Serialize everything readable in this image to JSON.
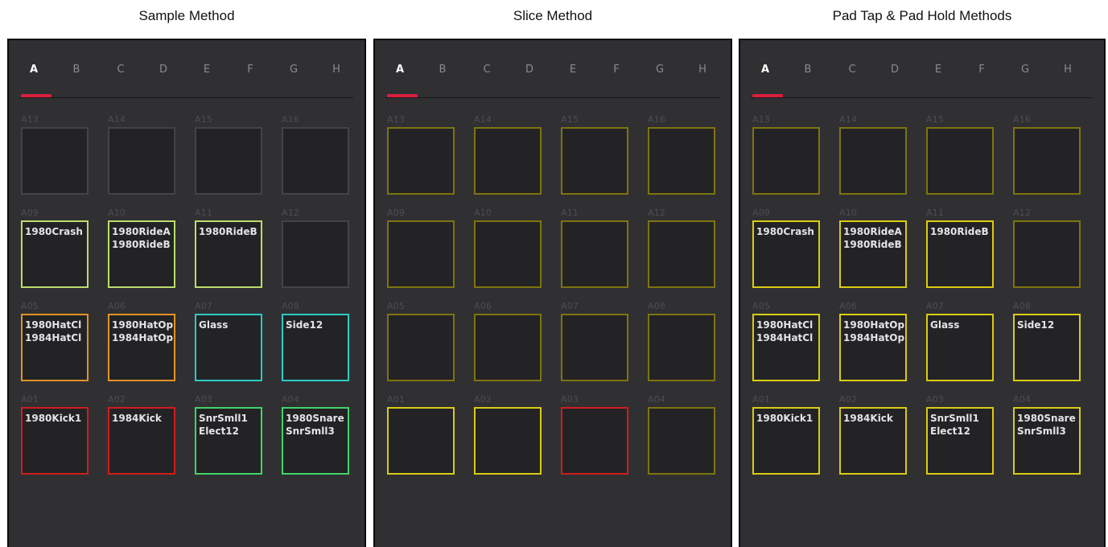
{
  "colors": {
    "empty": "#444447",
    "lime": "#bcdc6a",
    "orange": "#e29324",
    "cyan": "#2ccac3",
    "red": "#d11c1c",
    "green": "#3fd468",
    "yellow": "#d9cc12",
    "dim_yellow": "#7e740e",
    "tab_indicator": "#d81e3b"
  },
  "bank_tabs": [
    "A",
    "B",
    "C",
    "D",
    "E",
    "F",
    "G",
    "H"
  ],
  "active_tab": "A",
  "panels": [
    {
      "caption": "Sample Method",
      "rows": [
        [
          {
            "label": "A13",
            "text": "",
            "color": "empty"
          },
          {
            "label": "A14",
            "text": "",
            "color": "empty"
          },
          {
            "label": "A15",
            "text": "",
            "color": "empty"
          },
          {
            "label": "A16",
            "text": "",
            "color": "empty"
          }
        ],
        [
          {
            "label": "A09",
            "text": "1980Crash",
            "color": "lime"
          },
          {
            "label": "A10",
            "text": "1980RideA\n1980RideB",
            "color": "lime"
          },
          {
            "label": "A11",
            "text": "1980RideB",
            "color": "lime"
          },
          {
            "label": "A12",
            "text": "",
            "color": "empty"
          }
        ],
        [
          {
            "label": "A05",
            "text": "1980HatCl\n1984HatCl",
            "color": "orange"
          },
          {
            "label": "A06",
            "text": "1980HatOp\n1984HatOp",
            "color": "orange"
          },
          {
            "label": "A07",
            "text": "Glass",
            "color": "cyan"
          },
          {
            "label": "A08",
            "text": "Side12",
            "color": "cyan"
          }
        ],
        [
          {
            "label": "A01",
            "text": "1980Kick1",
            "color": "red"
          },
          {
            "label": "A02",
            "text": "1984Kick",
            "color": "red"
          },
          {
            "label": "A03",
            "text": "SnrSmll1\nElect12",
            "color": "green"
          },
          {
            "label": "A04",
            "text": "1980Snare\nSnrSmll3",
            "color": "green"
          }
        ]
      ]
    },
    {
      "caption": "Slice Method",
      "rows": [
        [
          {
            "label": "A13",
            "text": "",
            "color": "dim_yellow"
          },
          {
            "label": "A14",
            "text": "",
            "color": "dim_yellow"
          },
          {
            "label": "A15",
            "text": "",
            "color": "dim_yellow"
          },
          {
            "label": "A16",
            "text": "",
            "color": "dim_yellow"
          }
        ],
        [
          {
            "label": "A09",
            "text": "",
            "color": "dim_yellow"
          },
          {
            "label": "A10",
            "text": "",
            "color": "dim_yellow"
          },
          {
            "label": "A11",
            "text": "",
            "color": "dim_yellow"
          },
          {
            "label": "A12",
            "text": "",
            "color": "dim_yellow"
          }
        ],
        [
          {
            "label": "A05",
            "text": "",
            "color": "dim_yellow"
          },
          {
            "label": "A06",
            "text": "",
            "color": "dim_yellow"
          },
          {
            "label": "A07",
            "text": "",
            "color": "dim_yellow"
          },
          {
            "label": "A08",
            "text": "",
            "color": "dim_yellow"
          }
        ],
        [
          {
            "label": "A01",
            "text": "",
            "color": "yellow"
          },
          {
            "label": "A02",
            "text": "",
            "color": "yellow"
          },
          {
            "label": "A03",
            "text": "",
            "color": "red"
          },
          {
            "label": "A04",
            "text": "",
            "color": "dim_yellow"
          }
        ]
      ]
    },
    {
      "caption": "Pad Tap & Pad Hold Methods",
      "rows": [
        [
          {
            "label": "A13",
            "text": "",
            "color": "dim_yellow"
          },
          {
            "label": "A14",
            "text": "",
            "color": "dim_yellow"
          },
          {
            "label": "A15",
            "text": "",
            "color": "dim_yellow"
          },
          {
            "label": "A16",
            "text": "",
            "color": "dim_yellow"
          }
        ],
        [
          {
            "label": "A09",
            "text": "1980Crash",
            "color": "yellow"
          },
          {
            "label": "A10",
            "text": "1980RideA\n1980RideB",
            "color": "yellow"
          },
          {
            "label": "A11",
            "text": "1980RideB",
            "color": "yellow"
          },
          {
            "label": "A12",
            "text": "",
            "color": "dim_yellow"
          }
        ],
        [
          {
            "label": "A05",
            "text": "1980HatCl\n1984HatCl",
            "color": "yellow"
          },
          {
            "label": "A06",
            "text": "1980HatOp\n1984HatOp",
            "color": "yellow"
          },
          {
            "label": "A07",
            "text": "Glass",
            "color": "yellow"
          },
          {
            "label": "A08",
            "text": "Side12",
            "color": "yellow"
          }
        ],
        [
          {
            "label": "A01",
            "text": "1980Kick1",
            "color": "yellow"
          },
          {
            "label": "A02",
            "text": "1984Kick",
            "color": "yellow"
          },
          {
            "label": "A03",
            "text": "SnrSmll1\nElect12",
            "color": "yellow"
          },
          {
            "label": "A04",
            "text": "1980Snare\nSnrSmll3",
            "color": "yellow"
          }
        ]
      ]
    }
  ]
}
